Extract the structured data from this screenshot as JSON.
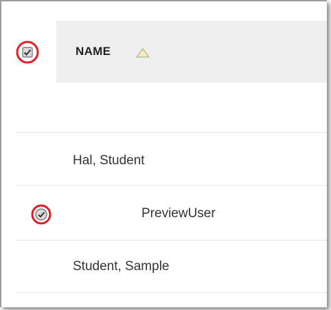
{
  "table": {
    "header": {
      "column_label": "NAME",
      "sort_direction": "ascending",
      "sort_icon": "triangle-up-icon"
    },
    "rows": [
      {
        "name": "",
        "checked": false
      },
      {
        "name": "Hal, Student",
        "checked": false
      },
      {
        "name": "PreviewUser",
        "checked": true
      },
      {
        "name": "Student, Sample",
        "checked": false
      }
    ]
  },
  "colors": {
    "header_bg": "#efefef",
    "highlight_ring": "#e31b23",
    "divider": "#e4e4e4",
    "text": "#333333"
  }
}
